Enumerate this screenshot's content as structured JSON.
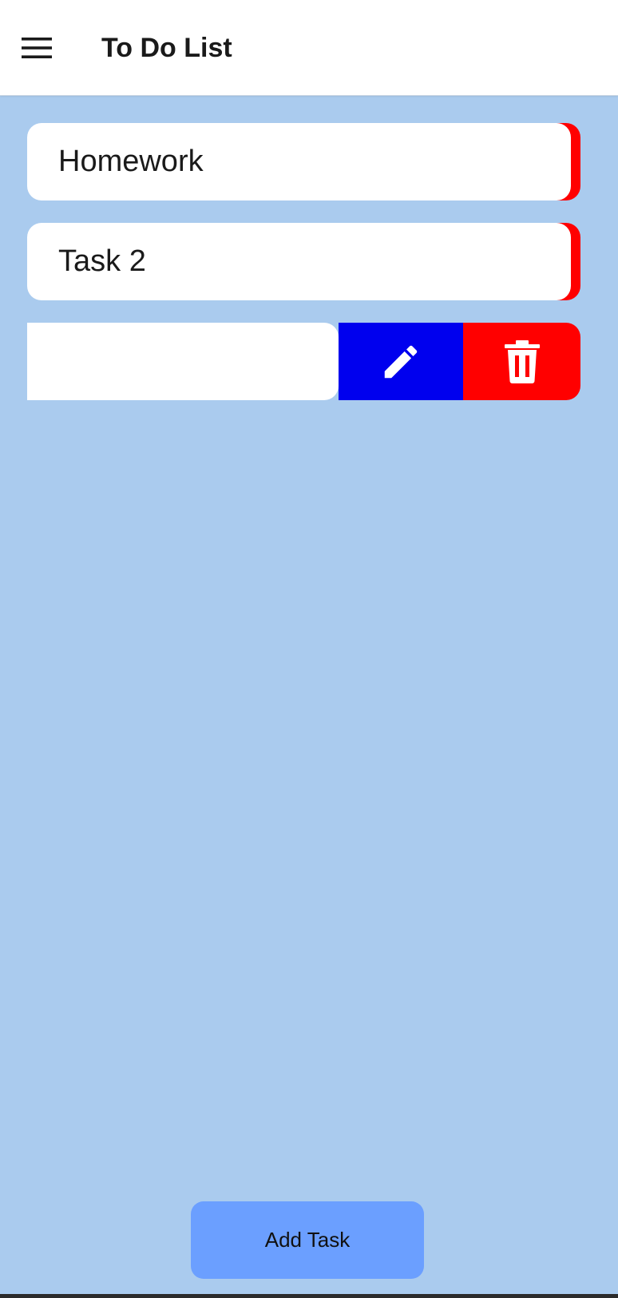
{
  "header": {
    "title": "To Do List",
    "menu_icon": "hamburger-menu-icon"
  },
  "tasks": [
    {
      "title": "Homework",
      "swiped_open": false
    },
    {
      "title": "Task 2",
      "swiped_open": false
    },
    {
      "title": "",
      "swiped_open": true
    }
  ],
  "swipe_actions": {
    "edit_icon": "pencil-icon",
    "delete_icon": "trash-icon"
  },
  "add_button": {
    "label": "Add Task"
  },
  "colors": {
    "background": "#aacbee",
    "header": "#ffffff",
    "card": "#ffffff",
    "edit": "#0000ee",
    "delete": "#ff0000",
    "add_button": "#6b9fff"
  }
}
